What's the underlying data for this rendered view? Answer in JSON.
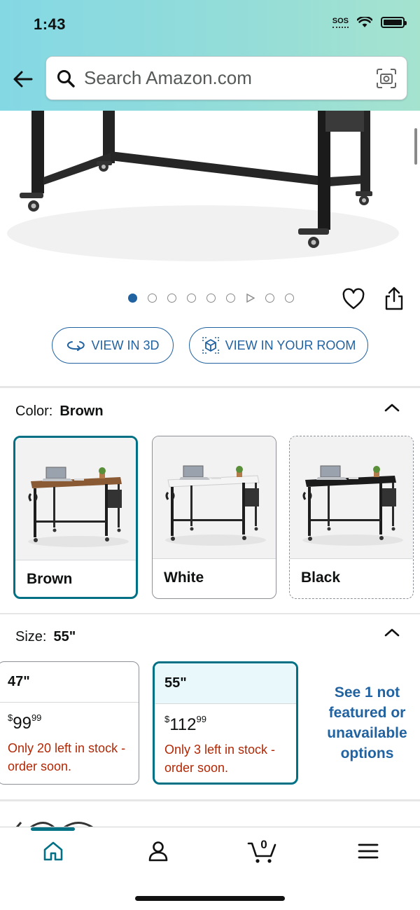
{
  "status_bar": {
    "time": "1:43",
    "sos": "SOS"
  },
  "search": {
    "placeholder": "Search Amazon.com"
  },
  "gallery": {
    "dot_count": 9,
    "active_index": 0,
    "video_index": 6
  },
  "actions": {
    "view_3d": "VIEW IN 3D",
    "view_room": "VIEW IN YOUR ROOM"
  },
  "color": {
    "label": "Color:",
    "selected": "Brown",
    "options": [
      {
        "name": "Brown",
        "top_color": "#8a5a34"
      },
      {
        "name": "White",
        "top_color": "#f4f4f4"
      },
      {
        "name": "Black",
        "top_color": "#1b1b1b"
      }
    ]
  },
  "size": {
    "label": "Size:",
    "selected": "55\"",
    "options": [
      {
        "size": "47\"",
        "currency": "$",
        "whole": "99",
        "fraction": "99",
        "stock": "Only 20 left in stock - order soon."
      },
      {
        "size": "55\"",
        "currency": "$",
        "whole": "112",
        "fraction": "99",
        "stock": "Only 3 left in stock - order soon."
      }
    ],
    "more_link": "See 1 not featured or unavailable options"
  },
  "cart": {
    "count": "0"
  },
  "colors": {
    "accent_teal": "#007185",
    "link_blue": "#2162a1",
    "stock_red": "#b12704"
  }
}
